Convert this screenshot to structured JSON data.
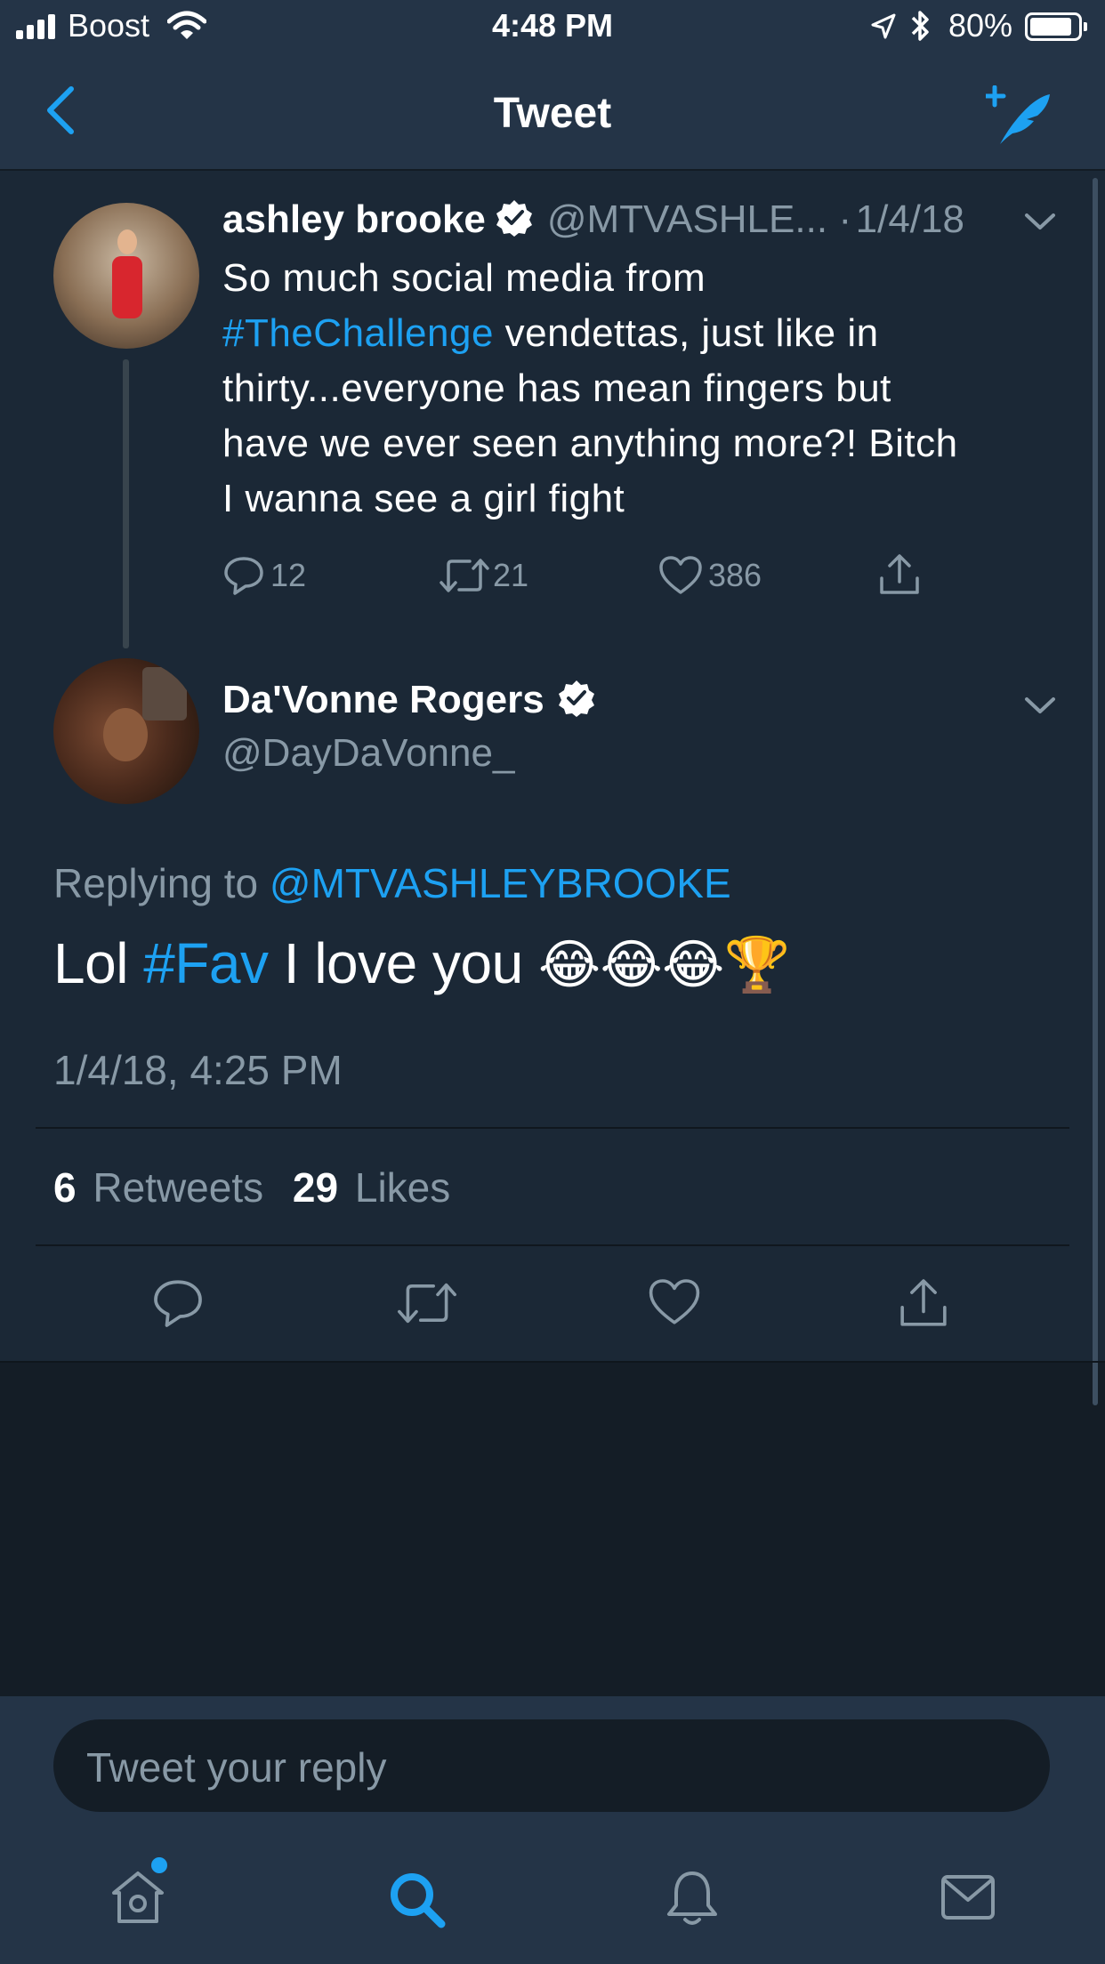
{
  "status_bar": {
    "carrier": "Boost",
    "time": "4:48 PM",
    "battery": "80%"
  },
  "nav": {
    "title": "Tweet"
  },
  "parent_tweet": {
    "name": "ashley brooke",
    "handle": "@MTVASHLE...",
    "separator": "·",
    "date": "1/4/18",
    "text_before": "So much social media from",
    "hashtag": "#TheChallenge",
    "text_after_line2": " vendettas, just like in",
    "text_line3": "thirty...everyone has mean fingers but",
    "text_line4": "have we ever seen anything more?! Bitch",
    "text_line5": "I wanna see a girl fight",
    "replies": "12",
    "retweets": "21",
    "likes": "386"
  },
  "main_tweet": {
    "name": "Da'Vonne Rogers",
    "handle": "@DayDaVonne_",
    "replying_prefix": "Replying to ",
    "replying_to": "@MTVASHLEYBROOKE",
    "text_start": "Lol ",
    "hashtag": "#Fav",
    "text_end": " I love you ",
    "emojis": "😂😂😂🏆",
    "timestamp": "1/4/18, 4:25 PM",
    "retweet_count": "6",
    "retweet_label": "Retweets",
    "like_count": "29",
    "like_label": "Likes"
  },
  "composer": {
    "placeholder": "Tweet your reply"
  },
  "tab_bar": {
    "items": [
      "home-icon",
      "search-icon",
      "notifications-icon",
      "messages-icon"
    ],
    "active": "search-icon"
  },
  "colors": {
    "accent": "#1da1f2",
    "background": "#141d26",
    "card": "#1b2836",
    "bar": "#243447",
    "muted": "#8899a6"
  }
}
